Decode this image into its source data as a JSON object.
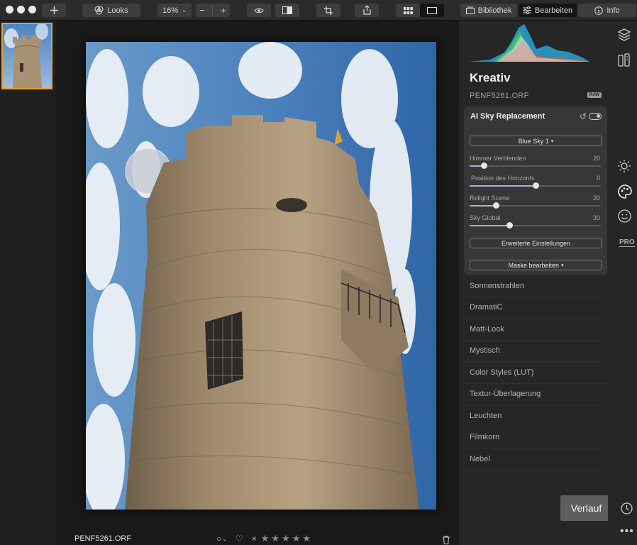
{
  "toolbar": {
    "looks_label": "Looks",
    "zoom_value": "16%",
    "bibliothek_label": "Bibliothek",
    "bearbeiten_label": "Bearbeiten",
    "info_label": "Info"
  },
  "photo": {
    "filename": "PENF5261.ORF",
    "rating_stars": 5,
    "flag_reject": "×",
    "color_label": "○",
    "heart": "♡"
  },
  "panel": {
    "title": "Kreativ",
    "filename": "PENF5261.ORF",
    "raw_badge": "RAW",
    "sky": {
      "title": "AI Sky Replacement",
      "preset": "Blue Sky 1",
      "sliders": [
        {
          "label": "Himmer Verblenden",
          "value": 20,
          "position": 0.11
        },
        {
          "label": "Position des Horizonts",
          "value": 0,
          "position": 0.5
        },
        {
          "label": "Relight Scene",
          "value": 20,
          "position": 0.2
        },
        {
          "label": "Sky Global",
          "value": 30,
          "position": 0.3
        }
      ],
      "advanced_label": "Erweiterte Einstellungen",
      "mask_label": "Maske bearbeiten"
    },
    "filters": [
      "Sonnenstrahlen",
      "DramatiC",
      "Matt-Look",
      "Mystisch",
      "Color Styles (LUT)",
      "Textur-Überlagerung",
      "Leuchten",
      "Filmkorn",
      "Nebel"
    ]
  },
  "verlauf_label": "Verlauf",
  "rail": {
    "pro_label": "PRO"
  },
  "colors": {
    "accent_border": "#e0a530",
    "slider_fill": "#9fb6d8"
  }
}
